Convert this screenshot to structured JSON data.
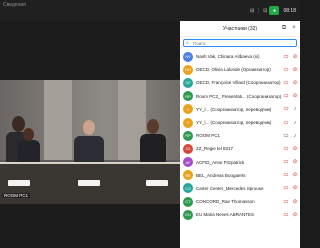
{
  "topbar": {
    "left_text": "Сведения",
    "right_items": [
      "⊟",
      "⋮",
      "⊡"
    ],
    "record_badge": "●",
    "time": "08:18"
  },
  "video": {
    "room_label": "ROOM PC1"
  },
  "participants_panel": {
    "title": "Участники (32)",
    "search_placeholder": "Поиск",
    "participants": [
      {
        "initials": "NV",
        "name": "Nash Vak, Chinara Aitbaeva (si)",
        "avatar_color": "#4c7de6",
        "video_muted": true,
        "mic_muted": true
      },
      {
        "initials": "OO",
        "name": "OECD, Olivia Lalonde (Организатор)",
        "avatar_color": "#e8a21c",
        "video_muted": true,
        "mic_muted": true
      },
      {
        "initials": "OF",
        "name": "OECD, Françoise Villard (Соорганизатор)",
        "avatar_color": "#27a69a",
        "video_muted": true,
        "mic_muted": true
      },
      {
        "initials": "RP",
        "name": "Room PC2_ Presentati... (Соорганизатор)",
        "avatar_color": "#2e9a4e",
        "video_muted": true,
        "mic_muted": true
      },
      {
        "initials": "Y",
        "name": "YY_l... (Соорганизатор, переводчик)",
        "avatar_color": "#e8a21c",
        "video_muted": true,
        "mic_muted": false
      },
      {
        "initials": "Y",
        "name": "YY_l... (Соорганизатор, переводчик)",
        "avatar_color": "#e8a21c",
        "video_muted": true,
        "mic_muted": false
      },
      {
        "initials": "RP",
        "name": "ROOM PC1",
        "avatar_color": "#2e9a4e",
        "video_muted": false,
        "mic_muted": false
      },
      {
        "initials": "ZZ",
        "name": "ZZ_Regie tel 8317",
        "avatar_color": "#d9453a",
        "video_muted": true,
        "mic_muted": true
      },
      {
        "initials": "AF",
        "name": "ACFID_Anne Fitzpatrick",
        "avatar_color": "#a54bc9",
        "video_muted": true,
        "mic_muted": true
      },
      {
        "initials": "BE",
        "name": "BEL_Andreas Boogaerts",
        "avatar_color": "#e8a21c",
        "video_muted": true,
        "mic_muted": true
      },
      {
        "initials": "CS",
        "name": "Carter Center_Mercedes Sprouse",
        "avatar_color": "#27a69a",
        "video_muted": true,
        "mic_muted": true
      },
      {
        "initials": "CT",
        "name": "CONCORD_Rae Thomasson",
        "avatar_color": "#2e9a4e",
        "video_muted": true,
        "mic_muted": true
      },
      {
        "initials": "EU",
        "name": "EU Maria Neves ABRANTES",
        "avatar_color": "#2e9a4e",
        "video_muted": true,
        "mic_muted": true
      }
    ]
  }
}
